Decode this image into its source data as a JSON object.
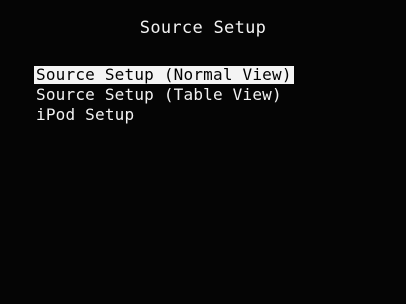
{
  "screen": {
    "title": "Source Setup"
  },
  "menu": {
    "selected_index": 0,
    "items": [
      {
        "label": "Source Setup (Normal View)"
      },
      {
        "label": "Source Setup (Table View)"
      },
      {
        "label": "iPod Setup"
      }
    ]
  },
  "colors": {
    "background": "#050505",
    "text": "#f2f2f2",
    "highlight_background": "#f4f4f4",
    "highlight_text": "#000000"
  }
}
